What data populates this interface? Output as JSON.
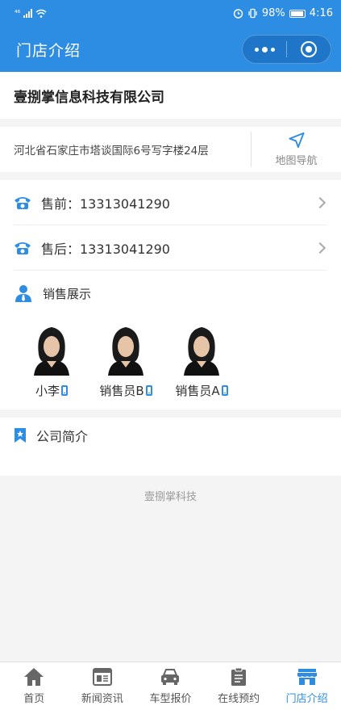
{
  "status_bar": {
    "signal": "⁴⁶",
    "battery": "98%",
    "time": "4:16"
  },
  "nav": {
    "title": "门店介绍"
  },
  "company": {
    "name": "壹捌掌信息科技有限公司"
  },
  "address": {
    "text": "河北省石家庄市塔谈国际6号写字楼24层",
    "nav_label": "地图导航"
  },
  "contact": {
    "presale": "售前：13313041290",
    "aftersale": "售后：13313041290",
    "sales_title": "销售展示",
    "people": [
      {
        "name": "小李"
      },
      {
        "name": "销售员B"
      },
      {
        "name": "销售员A"
      }
    ]
  },
  "intro": {
    "label": "公司简介"
  },
  "footer": {
    "brand": "壹捌掌科技"
  },
  "tabs": [
    {
      "label": "首页",
      "icon": "home-icon"
    },
    {
      "label": "新闻资讯",
      "icon": "news-icon"
    },
    {
      "label": "车型报价",
      "icon": "car-icon"
    },
    {
      "label": "在线预约",
      "icon": "clipboard-icon"
    },
    {
      "label": "门店介绍",
      "icon": "store-icon",
      "active": true
    }
  ],
  "colors": {
    "primary": "#2d8de2",
    "background": "#f4f4f4"
  }
}
